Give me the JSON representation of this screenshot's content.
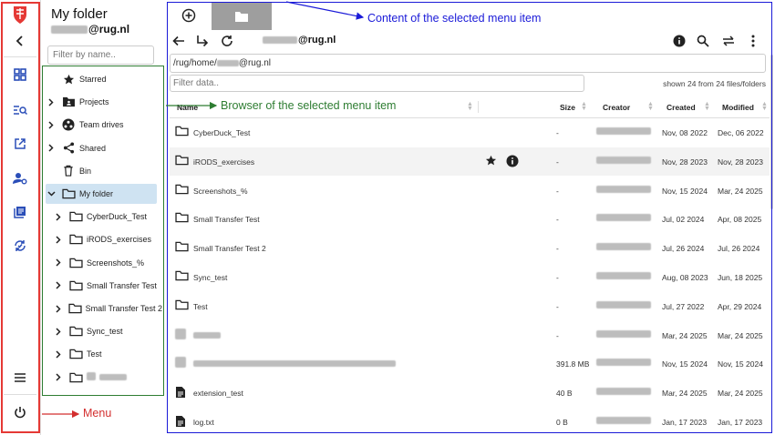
{
  "colors": {
    "menu_outline": "#e53935",
    "browser_outline": "#2e7d32",
    "content_outline": "#1a1ad8",
    "rail_icon": "#2a4eb8",
    "selected_row": "#cfe3f2"
  },
  "rail": {
    "icons": [
      "university-crest-icon",
      "back-chevron-icon",
      "dashboard-grid-icon",
      "search-list-icon",
      "open-external-icon",
      "user-settings-icon",
      "book-stack-icon",
      "sync-icon",
      "hamburger-menu-icon",
      "power-icon"
    ]
  },
  "panel": {
    "title": "My folder",
    "user_suffix": "@rug.nl",
    "filter_placeholder": "Filter by name..",
    "tree": [
      {
        "label": "Starred",
        "icon": "star-icon",
        "level": 0,
        "expandable": false
      },
      {
        "label": "Projects",
        "icon": "project-folder-icon",
        "level": 0,
        "expandable": true
      },
      {
        "label": "Team drives",
        "icon": "team-icon",
        "level": 0,
        "expandable": true
      },
      {
        "label": "Shared",
        "icon": "share-icon",
        "level": 0,
        "expandable": true
      },
      {
        "label": "Bin",
        "icon": "trash-icon",
        "level": 0,
        "expandable": false
      },
      {
        "label": "My folder",
        "icon": "folder-icon",
        "level": 0,
        "expandable": true,
        "expanded": true,
        "selected": true
      },
      {
        "label": "CyberDuck_Test",
        "icon": "folder-icon",
        "level": 1,
        "expandable": true
      },
      {
        "label": "iRODS_exercises",
        "icon": "folder-icon",
        "level": 1,
        "expandable": true
      },
      {
        "label": "Screenshots_%",
        "icon": "folder-icon",
        "level": 1,
        "expandable": true
      },
      {
        "label": "Small Transfer Test",
        "icon": "folder-icon",
        "level": 1,
        "expandable": true
      },
      {
        "label": "Small Transfer Test 2",
        "icon": "folder-icon",
        "level": 1,
        "expandable": true
      },
      {
        "label": "Sync_test",
        "icon": "folder-icon",
        "level": 1,
        "expandable": true
      },
      {
        "label": "Test",
        "icon": "folder-icon",
        "level": 1,
        "expandable": true
      },
      {
        "label": "",
        "icon": "folder-icon",
        "level": 1,
        "expandable": true,
        "redacted": true
      }
    ]
  },
  "content": {
    "user_suffix": "@rug.nl",
    "path_prefix": "/rug/home/",
    "path_suffix": "@rug.nl",
    "filter_placeholder": "Filter data..",
    "shown_count": "shown 24 from 24 files/folders",
    "columns": {
      "name": "Name",
      "size": "Size",
      "creator": "Creator",
      "created": "Created",
      "modified": "Modified"
    },
    "rows": [
      {
        "name": "CyberDuck_Test",
        "type": "folder",
        "size": "-",
        "created": "Nov, 08 2022",
        "modified": "Dec, 06 2022"
      },
      {
        "name": "iRODS_exercises",
        "type": "folder",
        "size": "-",
        "created": "Nov, 28 2023",
        "modified": "Nov, 28 2023",
        "hover": true
      },
      {
        "name": "Screenshots_%",
        "type": "folder",
        "size": "-",
        "created": "Nov, 15 2024",
        "modified": "Mar, 24 2025"
      },
      {
        "name": "Small Transfer Test",
        "type": "folder",
        "size": "-",
        "created": "Jul, 02 2024",
        "modified": "Apr, 08 2025"
      },
      {
        "name": "Small Transfer Test 2",
        "type": "folder",
        "size": "-",
        "created": "Jul, 26 2024",
        "modified": "Jul, 26 2024"
      },
      {
        "name": "Sync_test",
        "type": "folder",
        "size": "-",
        "created": "Aug, 08 2023",
        "modified": "Jun, 18 2025"
      },
      {
        "name": "Test",
        "type": "folder",
        "size": "-",
        "created": "Jul, 27 2022",
        "modified": "Apr, 29 2024"
      },
      {
        "name": "",
        "type": "redacted",
        "size": "-",
        "created": "Mar, 24 2025",
        "modified": "Mar, 24 2025"
      },
      {
        "name": "",
        "type": "redacted-file",
        "size": "391.8 MB",
        "created": "Nov, 15 2024",
        "modified": "Nov, 15 2024"
      },
      {
        "name": "extension_test",
        "type": "file",
        "size": "40 B",
        "created": "Mar, 24 2025",
        "modified": "Mar, 24 2025"
      },
      {
        "name": "log.txt",
        "type": "file",
        "size": "0 B",
        "created": "Jan, 17 2023",
        "modified": "Jan, 17 2023"
      }
    ]
  },
  "annotations": {
    "content": "Content of the selected menu item",
    "browser": "Browser of the selected menu item",
    "menu": "Menu"
  }
}
